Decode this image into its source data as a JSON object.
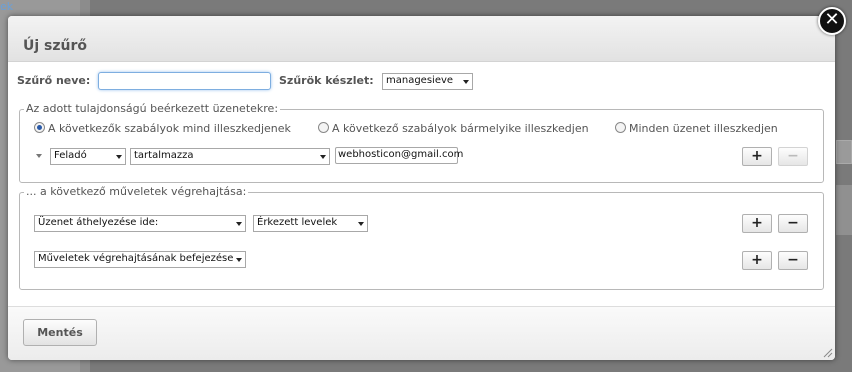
{
  "background": {
    "link_fragment": "ek"
  },
  "dialog": {
    "title": "Új szűrő",
    "close_symbol": "✕",
    "filter_name_label": "Szűrő neve:",
    "filter_name_value": "",
    "filter_set_label": "Szűrök készlet:",
    "filter_set_value": "managesieve",
    "conditions": {
      "legend": "Az adott tulajdonságú beérkezett üzenetekre:",
      "match_options": [
        {
          "label": "A következők szabályok mind illeszkedjenek",
          "checked": true
        },
        {
          "label": "A következő szabályok bármelyike illeszkedjen",
          "checked": false
        },
        {
          "label": "Minden üzenet illeszkedjen",
          "checked": false
        }
      ],
      "rule": {
        "header_field": "Feladó",
        "operator": "tartalmazza",
        "value": "webhosticon@gmail.com"
      },
      "add_label": "+",
      "remove_label": "−"
    },
    "actions": {
      "legend": "... a következő műveletek végrehajtása:",
      "rows": [
        {
          "action": "Üzenet áthelyezése ide:",
          "target": "Érkezett levelek"
        },
        {
          "action": "Műveletek végrehajtásának befejezése",
          "target": ""
        }
      ],
      "add_label": "+",
      "remove_label": "−"
    },
    "save_label": "Mentés"
  },
  "colors": {
    "overlay": "#7a7a7a",
    "focus_border": "#7eaee0",
    "radio_checked": "#2a5aa8"
  }
}
